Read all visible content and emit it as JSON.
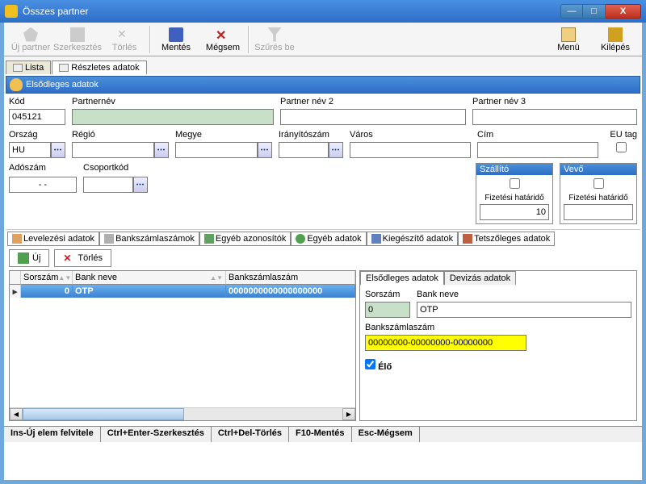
{
  "window": {
    "title": "Összes partner"
  },
  "toolbar": {
    "new": "Új partner",
    "edit": "Szerkesztés",
    "delete": "Törlés",
    "save": "Mentés",
    "cancel": "Mégsem",
    "filter": "Szűrés be",
    "menu": "Menü",
    "exit": "Kilépés"
  },
  "main_tabs": {
    "list": "Lista",
    "details": "Részletes adatok"
  },
  "section_primary": "Elsődleges adatok",
  "fields": {
    "kod_label": "Kód",
    "kod_value": "045121",
    "partnernev_label": "Partnernév",
    "partnernev2_label": "Partner név 2",
    "partnernev3_label": "Partner név 3",
    "orszag_label": "Ország",
    "orszag_value": "HU",
    "regio_label": "Régió",
    "megye_label": "Megye",
    "irszam_label": "Irányítószám",
    "varos_label": "Város",
    "cim_label": "Cím",
    "eutag_label": "EU tag",
    "adoszam_label": "Adószám",
    "adoszam_value": "- -",
    "csoportkod_label": "Csoportkód"
  },
  "supplier": {
    "title": "Szállító",
    "deadline_label": "Fizetési határidő",
    "deadline_value": "10"
  },
  "buyer": {
    "title": "Vevő",
    "deadline_label": "Fizetési határidő",
    "deadline_value": ""
  },
  "subtabs": {
    "t1": "Levelezési adatok",
    "t2": "Bankszámlaszámok",
    "t3": "Egyéb azonosítók",
    "t4": "Egyéb adatok",
    "t5": "Kiegészítő adatok",
    "t6": "Tetszőleges adatok"
  },
  "actions": {
    "new": "Új",
    "delete": "Törlés"
  },
  "grid": {
    "col_sorszam": "Sorszám",
    "col_banknev": "Bank neve",
    "col_bankszamla": "Bankszámlaszám",
    "row0_sorszam": "0",
    "row0_banknev": "OTP",
    "row0_bankszamla": "0000000000000000000"
  },
  "detail": {
    "tab1": "Elsődleges adatok",
    "tab2": "Devizás adatok",
    "sorszam_label": "Sorszám",
    "sorszam_value": "0",
    "banknev_label": "Bank neve",
    "banknev_value": "OTP",
    "bankszamla_label": "Bankszámlaszám",
    "bankszamla_value": "00000000-00000000-00000000",
    "elo_label": "Élő"
  },
  "status": {
    "s1": "Ins-Új elem felvitele",
    "s2": "Ctrl+Enter-Szerkesztés",
    "s3": "Ctrl+Del-Törlés",
    "s4": "F10-Mentés",
    "s5": "Esc-Mégsem"
  }
}
